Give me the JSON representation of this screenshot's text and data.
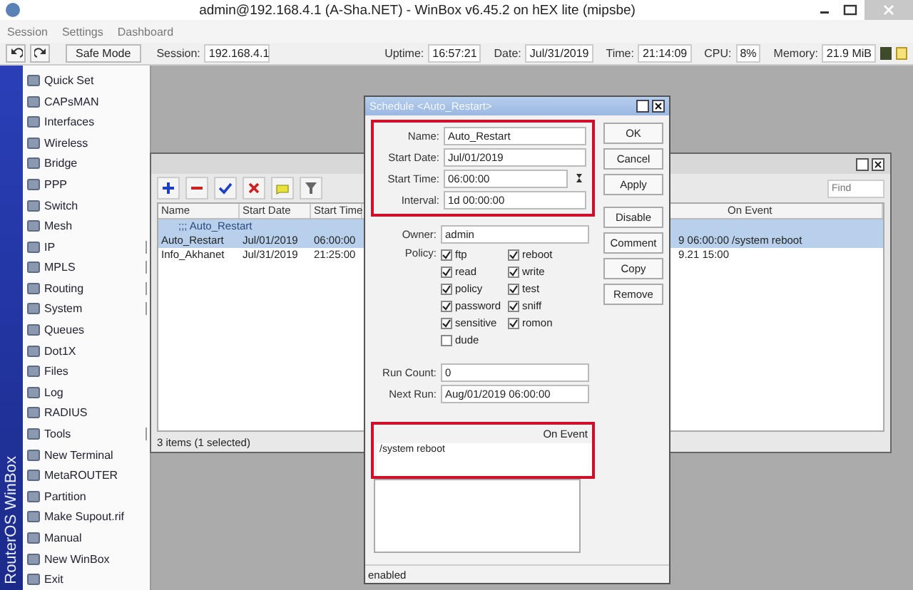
{
  "window": {
    "title": "admin@192.168.4.1 (A-Sha.NET) - WinBox v6.45.2 on hEX lite (mipsbe)"
  },
  "menu": [
    "Session",
    "Settings",
    "Dashboard"
  ],
  "toolbar": {
    "safe_mode": "Safe Mode",
    "session_label": "Session:",
    "session": "192.168.4.1",
    "stats": [
      {
        "label": "Uptime:",
        "value": "16:57:21"
      },
      {
        "label": "Date:",
        "value": "Jul/31/2019"
      },
      {
        "label": "Time:",
        "value": "21:14:09"
      },
      {
        "label": "CPU:",
        "value": "8%"
      },
      {
        "label": "Memory:",
        "value": "21.9 MiB"
      }
    ]
  },
  "sidebar": {
    "brand": "RouterOS WinBox",
    "items": [
      {
        "label": "Quick Set",
        "submenu": false
      },
      {
        "label": "CAPsMAN",
        "submenu": false
      },
      {
        "label": "Interfaces",
        "submenu": false
      },
      {
        "label": "Wireless",
        "submenu": false
      },
      {
        "label": "Bridge",
        "submenu": false
      },
      {
        "label": "PPP",
        "submenu": false
      },
      {
        "label": "Switch",
        "submenu": false
      },
      {
        "label": "Mesh",
        "submenu": false
      },
      {
        "label": "IP",
        "submenu": true
      },
      {
        "label": "MPLS",
        "submenu": true
      },
      {
        "label": "Routing",
        "submenu": true
      },
      {
        "label": "System",
        "submenu": true
      },
      {
        "label": "Queues",
        "submenu": false
      },
      {
        "label": "Dot1X",
        "submenu": false
      },
      {
        "label": "Files",
        "submenu": false
      },
      {
        "label": "Log",
        "submenu": false
      },
      {
        "label": "RADIUS",
        "submenu": false
      },
      {
        "label": "Tools",
        "submenu": true
      },
      {
        "label": "New Terminal",
        "submenu": false
      },
      {
        "label": "MetaROUTER",
        "submenu": false
      },
      {
        "label": "Partition",
        "submenu": false
      },
      {
        "label": "Make Supout.rif",
        "submenu": false
      },
      {
        "label": "Manual",
        "submenu": false
      },
      {
        "label": "New WinBox",
        "submenu": false
      },
      {
        "label": "Exit",
        "submenu": false
      }
    ]
  },
  "list_window": {
    "find": {
      "placeholder": "Find"
    },
    "columns": [
      {
        "label": "Name"
      },
      {
        "label": "Start Date"
      },
      {
        "label": "Start Time"
      },
      {
        "label": "On Event"
      }
    ],
    "rows": [
      {
        "kind": "comment",
        "text": ";;; Auto_Restart",
        "selected": true
      },
      {
        "kind": "item",
        "name": "Auto_Restart",
        "start_date": "Jul/01/2019",
        "start_time": "06:00:00",
        "tail": "9 06:00:00",
        "on_event": "/system reboot",
        "selected": true
      },
      {
        "kind": "item",
        "name": "Info_Akhanet",
        "start_date": "Jul/31/2019",
        "start_time": "21:25:00",
        "tail": "9.21 15:00",
        "selected": false
      }
    ],
    "status": "3 items (1 selected)"
  },
  "dialog": {
    "title": "Schedule <Auto_Restart>",
    "main_fields": {
      "highlighted": true,
      "fields": [
        {
          "label": "Name:",
          "value": "Auto_Restart",
          "kind": "text"
        },
        {
          "label": "Start Date:",
          "value": "Jul/01/2019",
          "kind": "text"
        },
        {
          "label": "Start Time:",
          "value": "06:00:00",
          "kind": "spin"
        },
        {
          "label": "Interval:",
          "value": "1d 00:00:00",
          "kind": "text"
        }
      ]
    },
    "owner": {
      "label": "Owner:",
      "value": "admin"
    },
    "policy": {
      "label": "Policy:",
      "options": [
        {
          "label": "ftp",
          "checked": true
        },
        {
          "label": "reboot",
          "checked": true
        },
        {
          "label": "read",
          "checked": true
        },
        {
          "label": "write",
          "checked": true
        },
        {
          "label": "policy",
          "checked": true
        },
        {
          "label": "test",
          "checked": true
        },
        {
          "label": "password",
          "checked": true
        },
        {
          "label": "sniff",
          "checked": true
        },
        {
          "label": "sensitive",
          "checked": true
        },
        {
          "label": "romon",
          "checked": true
        },
        {
          "label": "dude",
          "checked": false
        }
      ]
    },
    "run_count": {
      "label": "Run Count:",
      "value": "0"
    },
    "next_run": {
      "label": "Next Run:",
      "value": "Aug/01/2019 06:00:00"
    },
    "on_event": {
      "label": "On Event",
      "value": "/system reboot",
      "highlighted": true
    },
    "buttons": [
      "OK",
      "Cancel",
      "Apply",
      "Disable",
      "Comment",
      "Copy",
      "Remove"
    ],
    "status": "enabled"
  }
}
